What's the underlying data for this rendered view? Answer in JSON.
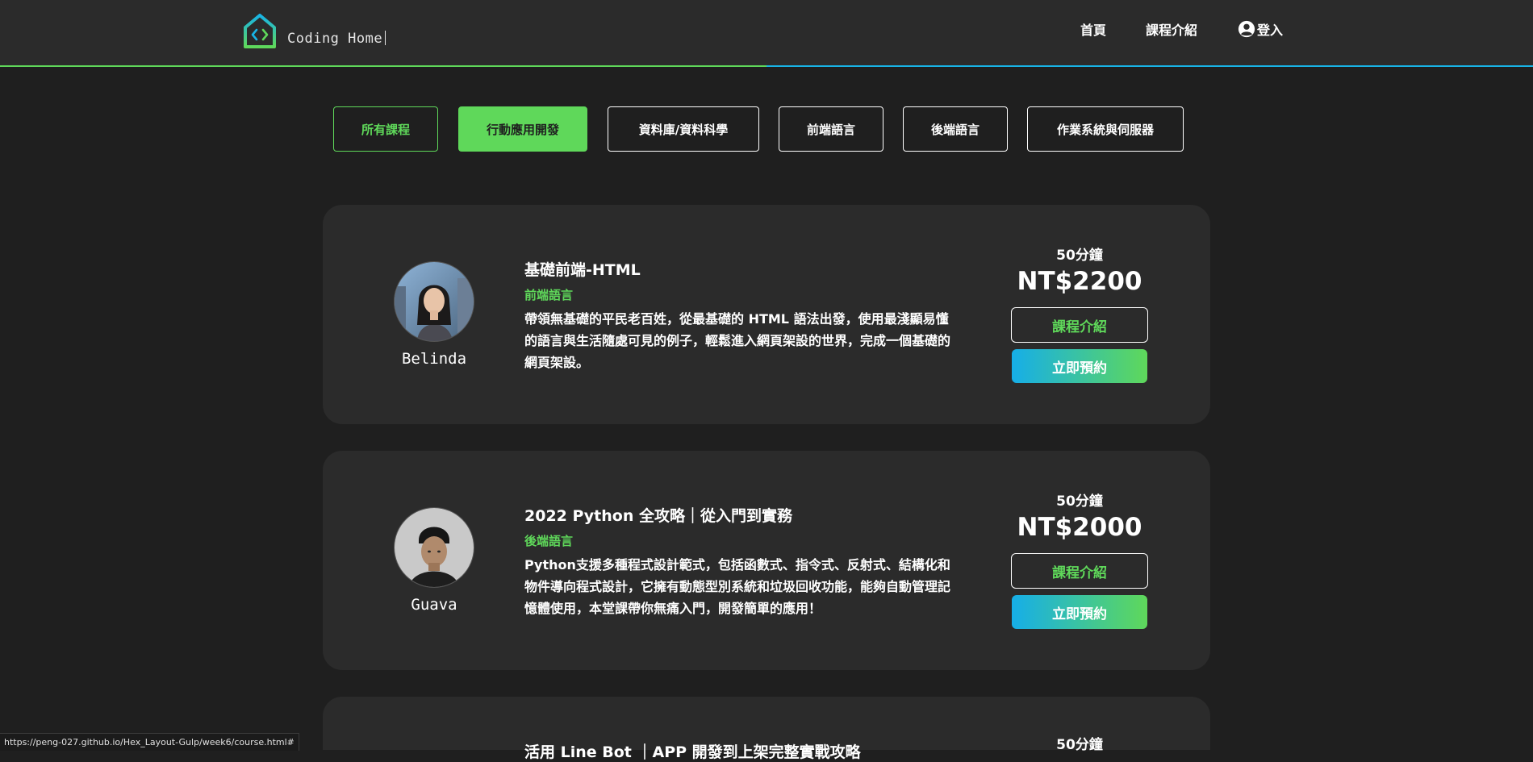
{
  "header": {
    "logo_text": "Coding Home",
    "nav": {
      "home": "首頁",
      "courses": "課程介紹",
      "login": "登入"
    }
  },
  "filters": [
    "所有課程",
    "行動應用開發",
    "資料庫/資料科學",
    "前端語言",
    "後端語言",
    "作業系統與伺服器"
  ],
  "courses": [
    {
      "teacher": "Belinda",
      "title": "基礎前端-HTML",
      "category": "前端語言",
      "description": "帶領無基礎的平民老百姓，從最基礎的 HTML 語法出發，使用最淺顯易懂的語言與生活隨處可見的例子，輕鬆進入網頁架設的世界，完成一個基礎的網頁架設。",
      "duration": "50分鐘",
      "price": "NT$2200",
      "intro_label": "課程介紹",
      "book_label": "立即預約"
    },
    {
      "teacher": "Guava",
      "title": "2022 Python 全攻略｜從入門到實務",
      "category": "後端語言",
      "description": "Python支援多種程式設計範式，包括函數式、指令式、反射式、結構化和物件導向程式設計，它擁有動態型別系統和垃圾回收功能，能夠自動管理記憶體使用，本堂課帶你無痛入門，開發簡單的應用！",
      "duration": "50分鐘",
      "price": "NT$2000",
      "intro_label": "課程介紹",
      "book_label": "立即預約"
    },
    {
      "title": "活用 Line Bot ｜APP 開發到上架完整實戰攻略",
      "duration": "50分鐘"
    }
  ],
  "status_url": "https://peng-027.github.io/Hex_Layout-Gulp/week6/course.html#",
  "colors": {
    "accent_green": "#5fd85a",
    "accent_blue": "#18b4e6",
    "background": "#1f1f1f",
    "card": "#2b2b2b"
  }
}
